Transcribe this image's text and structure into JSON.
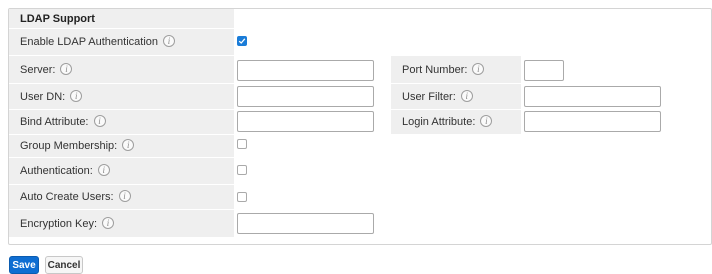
{
  "section_title": "LDAP Support",
  "enable_ldap": {
    "label": "Enable LDAP Authentication",
    "checked": true
  },
  "fields": {
    "server": {
      "label": "Server:",
      "value": ""
    },
    "port_number": {
      "label": "Port Number:",
      "value": ""
    },
    "user_dn": {
      "label": "User DN:",
      "value": ""
    },
    "user_filter": {
      "label": "User Filter:",
      "value": ""
    },
    "bind_attribute": {
      "label": "Bind Attribute:",
      "value": ""
    },
    "login_attribute": {
      "label": "Login Attribute:",
      "value": ""
    },
    "group_membership": {
      "label": "Group Membership:",
      "checked": false
    },
    "authentication": {
      "label": "Authentication:",
      "checked": false
    },
    "auto_create_users": {
      "label": "Auto Create Users:",
      "checked": false
    },
    "encryption_key": {
      "label": "Encryption Key:",
      "value": ""
    }
  },
  "icons": {
    "info": "i"
  },
  "buttons": {
    "save": "Save",
    "cancel": "Cancel"
  },
  "colors": {
    "primary": "#0f6ed2",
    "label_bg": "#efefef",
    "border": "#d4d4d4"
  }
}
